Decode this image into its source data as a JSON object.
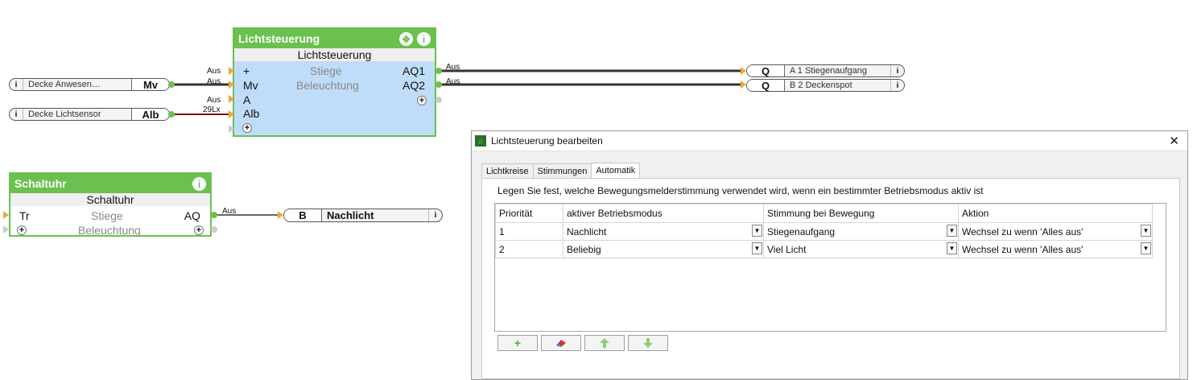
{
  "inputs": [
    {
      "name": "Decke Anwesen…",
      "tag": "Mv"
    },
    {
      "name": "Decke Lichtsensor",
      "tag": "Alb"
    }
  ],
  "outputs": [
    {
      "tag": "Q",
      "name": "A 1 Stiegenaufgang"
    },
    {
      "tag": "Q",
      "name": "B 2 Deckenspot"
    },
    {
      "tag": "B",
      "name": "Nachlicht"
    }
  ],
  "lichtsteuerung_block": {
    "title": "Lichtsteuerung",
    "subtitle": "Lichtsteuerung",
    "line1": "Stiege",
    "line2": "Beleuchtung",
    "inputs": [
      "+",
      "Mv",
      "A",
      "Alb"
    ],
    "outputs": [
      "AQ1",
      "AQ2"
    ],
    "input_values": [
      "Aus",
      "Aus",
      "Aus",
      "29Lx"
    ],
    "output_values": [
      "Aus",
      "Aus"
    ]
  },
  "schaltuhr_block": {
    "title": "Schaltuhr",
    "subtitle": "Schaltuhr",
    "line1": "Stiege",
    "line2": "Beleuchtung",
    "input": "Tr",
    "output": "AQ",
    "output_value": "Aus"
  },
  "dialog": {
    "title": "Lichtsteuerung bearbeiten",
    "tabs": [
      "Lichtkreise",
      "Stimmungen",
      "Automatik"
    ],
    "active_tab": "Automatik",
    "description": "Legen Sie fest, welche Bewegungsmelderstimmung verwendet wird, wenn ein bestimmter Betriebsmodus aktiv ist",
    "columns": [
      "Priorität",
      "aktiver Betriebsmodus",
      "Stimmung bei Bewegung",
      "Aktion"
    ],
    "rows": [
      {
        "prio": "1",
        "modus": "Nachlicht",
        "stimmung": "Stiegenaufgang",
        "aktion": "Wechsel zu wenn 'Alles aus'"
      },
      {
        "prio": "2",
        "modus": "Beliebig",
        "stimmung": "Viel Licht",
        "aktion": "Wechsel zu wenn 'Alles aus'"
      }
    ]
  },
  "icons": {
    "info": "i",
    "plus": "+",
    "close": "✕",
    "dropdown": "▼"
  },
  "colors": {
    "accent": "#6ac14f",
    "block_body": "#bfdcf8",
    "wire_dark": "#333333",
    "wire_red": "#7a1414"
  }
}
